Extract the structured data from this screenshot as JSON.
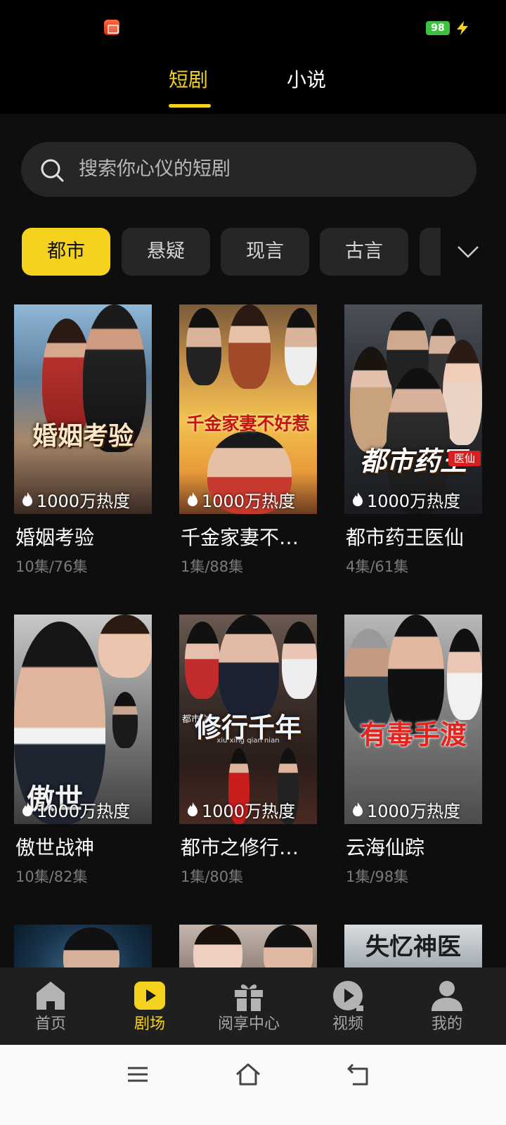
{
  "status_bar": {
    "battery": "98"
  },
  "top_tabs": {
    "active": "短剧",
    "inactive": "小说"
  },
  "search": {
    "placeholder": "搜索你心仪的短剧"
  },
  "categories": [
    "都市",
    "悬疑",
    "现言",
    "古言"
  ],
  "cards": [
    {
      "title": "婚姻考验",
      "episodes": "10集/76集",
      "heat": "1000万热度",
      "poster_text": "婚姻考验"
    },
    {
      "title": "千金家妻不…",
      "episodes": "1集/88集",
      "heat": "1000万热度",
      "poster_text": "千金家妻不好惹"
    },
    {
      "title": "都市药王医仙",
      "episodes": "4集/61集",
      "heat": "1000万热度",
      "poster_text": "都市药王",
      "poster_badge": "医仙"
    },
    {
      "title": "傲世战神",
      "episodes": "10集/82集",
      "heat": "1000万热度",
      "poster_text": "傲世"
    },
    {
      "title": "都市之修行…",
      "episodes": "1集/80集",
      "heat": "1000万热度",
      "poster_text": "修行千年",
      "poster_small": "都市之",
      "poster_pinyin": "xiu xing qian nian"
    },
    {
      "title": "云海仙踪",
      "episodes": "1集/98集",
      "heat": "1000万热度",
      "poster_text": "有毒手渡"
    }
  ],
  "partial_posters": [
    {
      "poster_text": ""
    },
    {
      "poster_text": ""
    },
    {
      "poster_text": "失忆神医"
    }
  ],
  "bottom_nav": {
    "items": [
      {
        "label": "首页",
        "icon": "home-icon"
      },
      {
        "label": "剧场",
        "icon": "play-icon",
        "active": true
      },
      {
        "label": "阅享中心",
        "icon": "gift-icon"
      },
      {
        "label": "视频",
        "icon": "video-icon"
      },
      {
        "label": "我的",
        "icon": "profile-icon"
      }
    ]
  },
  "colors": {
    "accent": "#f5d21e",
    "background": "#0e0e0e",
    "chip": "#262626"
  }
}
